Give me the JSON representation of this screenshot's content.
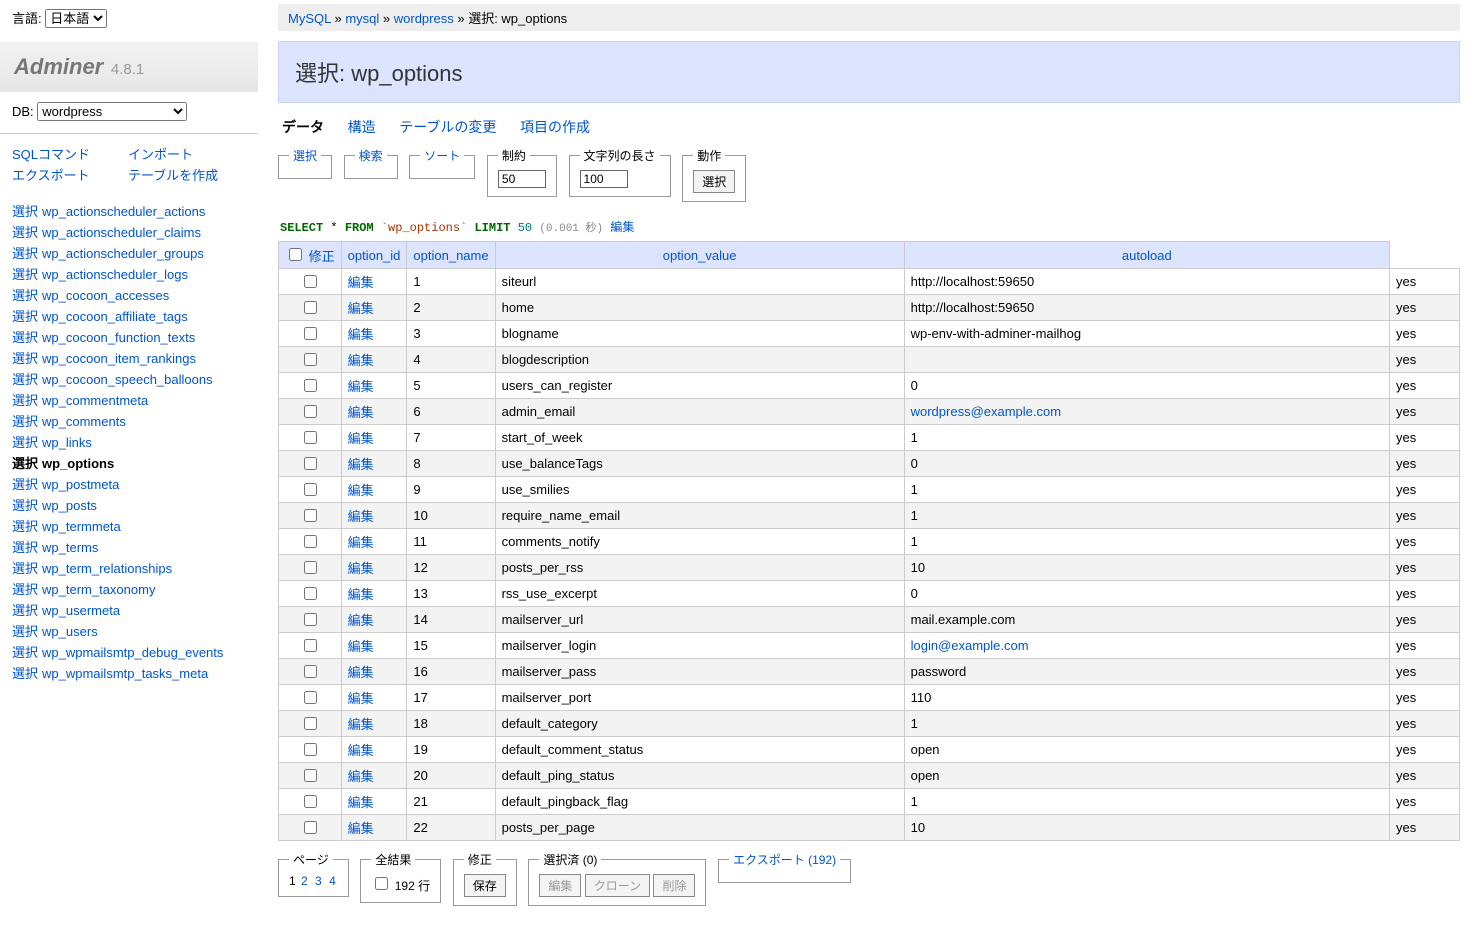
{
  "lang": {
    "label": "言語:",
    "value": "日本語"
  },
  "logo": {
    "name": "Adminer",
    "version": "4.8.1"
  },
  "db": {
    "label": "DB:",
    "value": "wordpress"
  },
  "menu_links": {
    "sql": "SQLコマンド",
    "import": "インポート",
    "export": "エクスポート",
    "create": "テーブルを作成"
  },
  "select_label": "選択",
  "tables": [
    "wp_actionscheduler_actions",
    "wp_actionscheduler_claims",
    "wp_actionscheduler_groups",
    "wp_actionscheduler_logs",
    "wp_cocoon_accesses",
    "wp_cocoon_affiliate_tags",
    "wp_cocoon_function_texts",
    "wp_cocoon_item_rankings",
    "wp_cocoon_speech_balloons",
    "wp_commentmeta",
    "wp_comments",
    "wp_links",
    "wp_options",
    "wp_postmeta",
    "wp_posts",
    "wp_termmeta",
    "wp_terms",
    "wp_term_relationships",
    "wp_term_taxonomy",
    "wp_usermeta",
    "wp_users",
    "wp_wpmailsmtp_debug_events",
    "wp_wpmailsmtp_tasks_meta"
  ],
  "current_table": "wp_options",
  "breadcrumb": {
    "server": "MySQL",
    "db": "mysql",
    "table": "wordpress",
    "page": "選択: wp_options"
  },
  "h2": "選択: wp_options",
  "tabs": {
    "data": "データ",
    "structure": "構造",
    "alter": "テーブルの変更",
    "new": "項目の作成"
  },
  "fs": {
    "select": "選択",
    "search": "検索",
    "sort": "ソート",
    "limit": "制約",
    "limit_val": "50",
    "textlen": "文字列の長さ",
    "textlen_val": "100",
    "action": "動作",
    "action_btn": "選択"
  },
  "sql": {
    "select": "SELECT",
    "star": "*",
    "from": "FROM",
    "tbl": "`wp_options`",
    "limit": "LIMIT",
    "n": "50",
    "time": "(0.001 秒)",
    "edit": "編集"
  },
  "thead": {
    "modify": "修正",
    "c1": "option_id",
    "c2": "option_name",
    "c3": "option_value",
    "c4": "autoload"
  },
  "edit_label": "編集",
  "rows": [
    {
      "id": "1",
      "name": "siteurl",
      "val": "http://localhost:59650",
      "auto": "yes",
      "link": false
    },
    {
      "id": "2",
      "name": "home",
      "val": "http://localhost:59650",
      "auto": "yes",
      "link": false
    },
    {
      "id": "3",
      "name": "blogname",
      "val": "wp-env-with-adminer-mailhog",
      "auto": "yes",
      "link": false
    },
    {
      "id": "4",
      "name": "blogdescription",
      "val": "",
      "auto": "yes",
      "link": false
    },
    {
      "id": "5",
      "name": "users_can_register",
      "val": "0",
      "auto": "yes",
      "link": false
    },
    {
      "id": "6",
      "name": "admin_email",
      "val": "wordpress@example.com",
      "auto": "yes",
      "link": true
    },
    {
      "id": "7",
      "name": "start_of_week",
      "val": "1",
      "auto": "yes",
      "link": false
    },
    {
      "id": "8",
      "name": "use_balanceTags",
      "val": "0",
      "auto": "yes",
      "link": false
    },
    {
      "id": "9",
      "name": "use_smilies",
      "val": "1",
      "auto": "yes",
      "link": false
    },
    {
      "id": "10",
      "name": "require_name_email",
      "val": "1",
      "auto": "yes",
      "link": false
    },
    {
      "id": "11",
      "name": "comments_notify",
      "val": "1",
      "auto": "yes",
      "link": false
    },
    {
      "id": "12",
      "name": "posts_per_rss",
      "val": "10",
      "auto": "yes",
      "link": false
    },
    {
      "id": "13",
      "name": "rss_use_excerpt",
      "val": "0",
      "auto": "yes",
      "link": false
    },
    {
      "id": "14",
      "name": "mailserver_url",
      "val": "mail.example.com",
      "auto": "yes",
      "link": false
    },
    {
      "id": "15",
      "name": "mailserver_login",
      "val": "login@example.com",
      "auto": "yes",
      "link": true
    },
    {
      "id": "16",
      "name": "mailserver_pass",
      "val": "password",
      "auto": "yes",
      "link": false
    },
    {
      "id": "17",
      "name": "mailserver_port",
      "val": "110",
      "auto": "yes",
      "link": false
    },
    {
      "id": "18",
      "name": "default_category",
      "val": "1",
      "auto": "yes",
      "link": false
    },
    {
      "id": "19",
      "name": "default_comment_status",
      "val": "open",
      "auto": "yes",
      "link": false
    },
    {
      "id": "20",
      "name": "default_ping_status",
      "val": "open",
      "auto": "yes",
      "link": false
    },
    {
      "id": "21",
      "name": "default_pingback_flag",
      "val": "1",
      "auto": "yes",
      "link": false
    },
    {
      "id": "22",
      "name": "posts_per_page",
      "val": "10",
      "auto": "yes",
      "link": false
    }
  ],
  "footer": {
    "page": "ページ",
    "pages": [
      "1",
      "2",
      "3",
      "4"
    ],
    "whole": "全結果",
    "whole_cb": "192 行",
    "modify": "修正",
    "save": "保存",
    "selected": "選択済 (0)",
    "edit": "編集",
    "clone": "クローン",
    "delete": "削除",
    "export": "エクスポート (192)"
  }
}
